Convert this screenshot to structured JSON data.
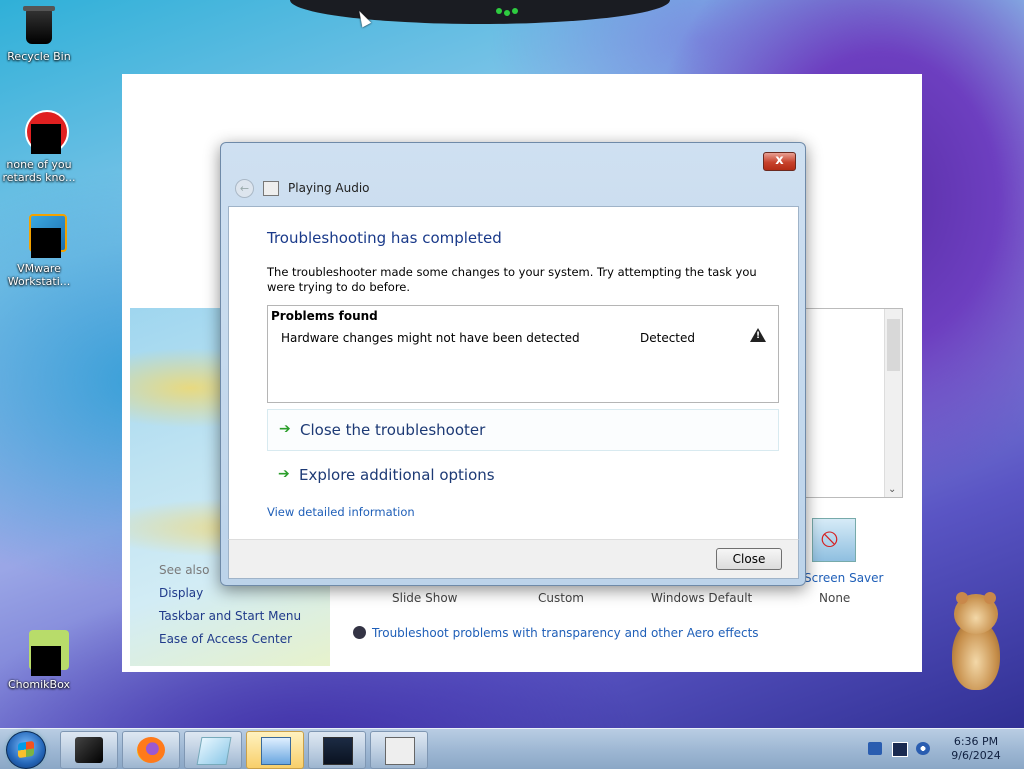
{
  "desktop": {
    "icons": [
      {
        "label": "Recycle Bin"
      },
      {
        "label": "none of you retards kno..."
      },
      {
        "label": "VMware Workstati..."
      },
      {
        "label": "ChomikBox"
      }
    ]
  },
  "control_panel": {
    "see_also": "See also",
    "links": [
      "Display",
      "Taskbar and Start Menu",
      "Ease of Access Center"
    ],
    "columns": [
      "Slide Show",
      "Custom",
      "Windows Default",
      "None"
    ],
    "screen_saver_label": "Screen Saver",
    "aero_link": "Troubleshoot problems with transparency and other Aero effects"
  },
  "dialog": {
    "close_x": "x",
    "nav_title": "Playing Audio",
    "heading": "Troubleshooting has completed",
    "description": "The troubleshooter made some changes to your system. Try attempting the task you were trying to do before.",
    "problems_title": "Problems found",
    "problem": {
      "text": "Hardware changes might not have been detected",
      "status": "Detected"
    },
    "options": [
      "Close the troubleshooter",
      "Explore additional options"
    ],
    "detail_link": "View detailed information",
    "close_button": "Close"
  },
  "taskbar": {
    "time": "6:36 PM",
    "date": "9/6/2024"
  }
}
